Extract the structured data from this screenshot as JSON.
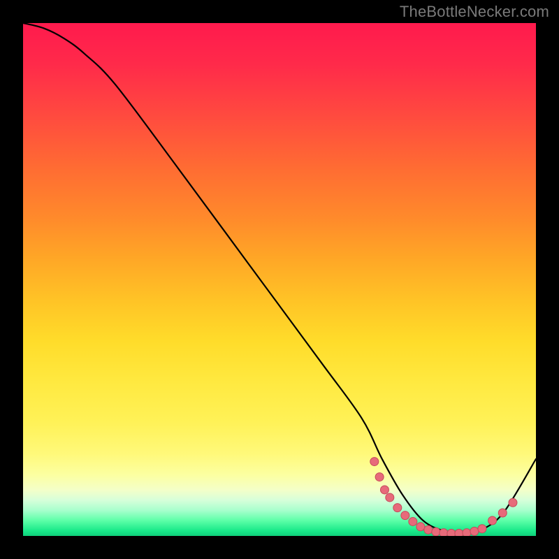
{
  "watermark": "TheBottleNecker.com",
  "colors": {
    "curve": "#000000",
    "marker_fill": "#e76a7a",
    "marker_stroke": "#c44a5a"
  },
  "chart_data": {
    "type": "line",
    "title": "",
    "xlabel": "",
    "ylabel": "",
    "xlim": [
      0,
      100
    ],
    "ylim": [
      0,
      100
    ],
    "curve": {
      "x": [
        0,
        4,
        8,
        12,
        18,
        30,
        44,
        58,
        66,
        70,
        74,
        78,
        82,
        86,
        90,
        94,
        100
      ],
      "y": [
        100,
        99,
        97,
        94,
        88,
        72,
        53,
        34,
        23,
        15,
        8,
        3,
        1,
        0.5,
        1.5,
        5,
        15
      ]
    },
    "series": [
      {
        "name": "markers",
        "type": "scatter",
        "points": [
          {
            "x": 68.5,
            "y": 14.5
          },
          {
            "x": 69.5,
            "y": 11.5
          },
          {
            "x": 70.5,
            "y": 9.0
          },
          {
            "x": 71.5,
            "y": 7.5
          },
          {
            "x": 73.0,
            "y": 5.5
          },
          {
            "x": 74.5,
            "y": 4.0
          },
          {
            "x": 76.0,
            "y": 2.8
          },
          {
            "x": 77.5,
            "y": 1.8
          },
          {
            "x": 79.0,
            "y": 1.2
          },
          {
            "x": 80.5,
            "y": 0.8
          },
          {
            "x": 82.0,
            "y": 0.6
          },
          {
            "x": 83.5,
            "y": 0.5
          },
          {
            "x": 85.0,
            "y": 0.5
          },
          {
            "x": 86.5,
            "y": 0.6
          },
          {
            "x": 88.0,
            "y": 0.9
          },
          {
            "x": 89.5,
            "y": 1.4
          },
          {
            "x": 91.5,
            "y": 3.0
          },
          {
            "x": 93.5,
            "y": 4.5
          },
          {
            "x": 95.5,
            "y": 6.5
          }
        ]
      }
    ]
  }
}
